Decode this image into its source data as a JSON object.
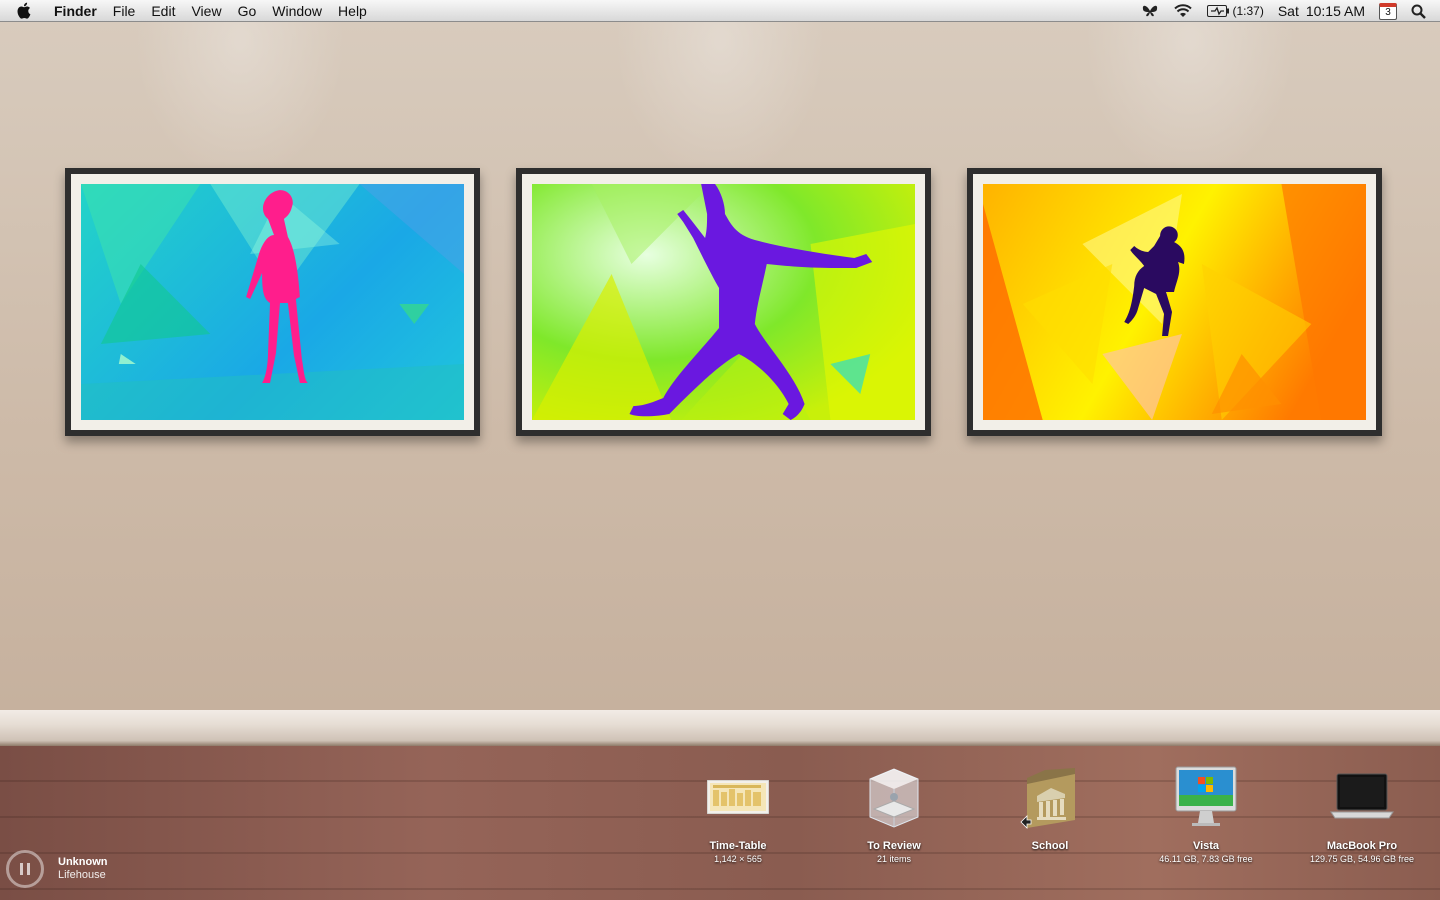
{
  "menubar": {
    "app": "Finder",
    "items": [
      "File",
      "Edit",
      "View",
      "Go",
      "Window",
      "Help"
    ],
    "battery_time": "(1:37)",
    "day": "Sat",
    "time": "10:15 AM",
    "calendar_date": "3"
  },
  "desktop_icons": [
    {
      "name": "Time-Table",
      "sub": "1,142 × 565",
      "icon": "image-file-icon"
    },
    {
      "name": "To Review",
      "sub": "21 items",
      "icon": "glass-box-folder-icon"
    },
    {
      "name": "School",
      "sub": "",
      "icon": "school-folder-alias-icon"
    },
    {
      "name": "Vista",
      "sub": "46.11 GB, 7.83 GB free",
      "icon": "imac-windows-drive-icon"
    },
    {
      "name": "MacBook Pro",
      "sub": "129.75 GB, 54.96 GB free",
      "icon": "macbook-drive-icon"
    }
  ],
  "music": {
    "title": "Unknown",
    "artist": "Lifehouse"
  }
}
